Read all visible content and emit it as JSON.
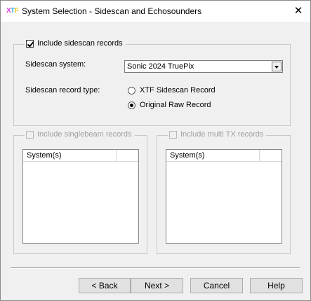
{
  "window": {
    "title": "System Selection - Sidescan and Echosounders",
    "close_glyph": "✕"
  },
  "sidescan_group": {
    "checkbox_label": "Include sidescan records",
    "checked": true,
    "system_label": "Sidescan system:",
    "system_value": "Sonic 2024 TruePix",
    "record_type_label": "Sidescan record type:",
    "record_type_options": [
      "XTF Sidescan Record",
      "Original Raw Record"
    ],
    "record_type_selected": "Original Raw Record"
  },
  "singlebeam_group": {
    "checkbox_label": "Include singlebeam records",
    "checked": false,
    "enabled": false,
    "column_header": "System(s)"
  },
  "multitx_group": {
    "checkbox_label": "Include multi TX records",
    "checked": false,
    "enabled": false,
    "column_header": "System(s)"
  },
  "buttons": {
    "back": "< Back",
    "next": "Next >",
    "cancel": "Cancel",
    "help": "Help"
  },
  "icons": {
    "app": "xtf-app-icon",
    "close": "close-icon"
  }
}
